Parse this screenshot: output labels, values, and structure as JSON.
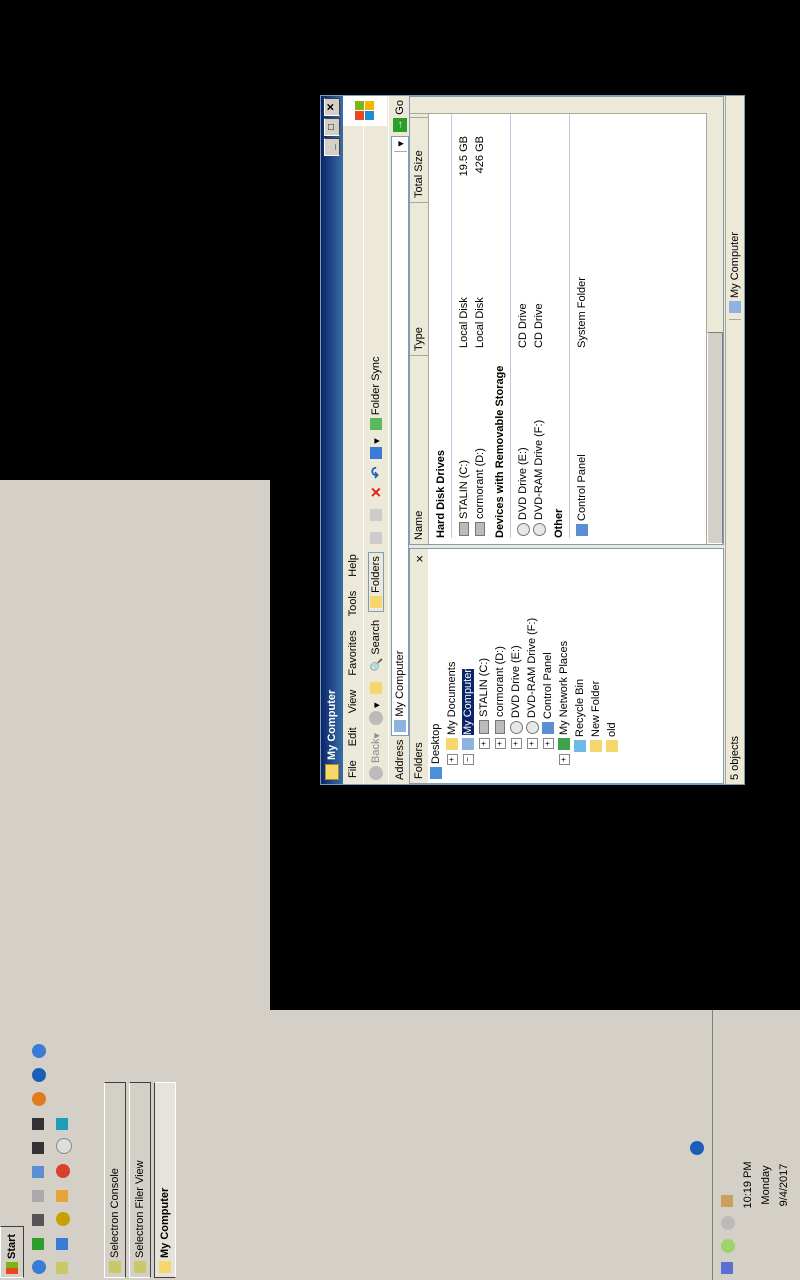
{
  "window": {
    "title": "My Computer",
    "menu": [
      "File",
      "Edit",
      "View",
      "Favorites",
      "Tools",
      "Help"
    ],
    "toolbar": {
      "back": "Back",
      "search": "Search",
      "folders": "Folders",
      "folder_sync": "Folder Sync"
    },
    "address": {
      "label": "Address",
      "value": "My Computer",
      "go": "Go"
    },
    "folders_pane": {
      "title": "Folders",
      "close": "×",
      "tree": [
        "Desktop",
        "My Documents",
        "My Computer",
        "STALIN (C:)",
        "cormorant (D:)",
        "DVD Drive (E:)",
        "DVD-RAM Drive (F:)",
        "Control Panel",
        "My Network Places",
        "Recycle Bin",
        "New Folder",
        "old"
      ]
    },
    "columns": [
      "Name",
      "Type",
      "Total Size"
    ],
    "groups": [
      {
        "title": "Hard Disk Drives",
        "items": [
          {
            "name": "STALIN (C:)",
            "type": "Local Disk",
            "size": "19.5 GB"
          },
          {
            "name": "cormorant (D:)",
            "type": "Local Disk",
            "size": "426 GB"
          }
        ]
      },
      {
        "title": "Devices with Removable Storage",
        "items": [
          {
            "name": "DVD Drive (E:)",
            "type": "CD Drive",
            "size": ""
          },
          {
            "name": "DVD-RAM Drive (F:)",
            "type": "CD Drive",
            "size": ""
          }
        ]
      },
      {
        "title": "Other",
        "items": [
          {
            "name": "Control Panel",
            "type": "System Folder",
            "size": ""
          }
        ]
      }
    ],
    "status": {
      "objects": "5 objects",
      "location": "My Computer"
    }
  },
  "taskbar": {
    "start": "Start",
    "tasks": [
      "Selectron Console",
      "Selectron Filer View",
      "My Computer"
    ],
    "clock": {
      "time": "10:19 PM",
      "day": "Monday",
      "date": "9/4/2017"
    }
  }
}
